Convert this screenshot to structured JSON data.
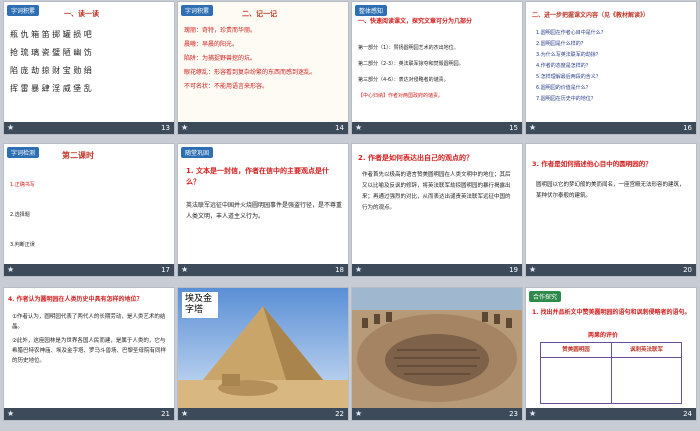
{
  "slides": [
    {
      "num": "13",
      "tag": "字词积累",
      "title": "一、读一读",
      "lines": [
        "瓶 仇 箱 笛 掷 罐 损 吧",
        "抢 琉 璃 瓷 璧 陋 幽 饬",
        "陷 庞 劫 掠 财 宝 勋 绢",
        "挥 雷 暴 肆 淫 威 堡 乱"
      ]
    },
    {
      "num": "14",
      "tag": "字词积累",
      "title": "二、记一记",
      "lines": [
        "瑰丽：奇特，珍贵而华丽。",
        "晨曦：早晨的阳光。",
        "陷阱：为捕捉野兽挖的坑。",
        "眼花缭乱：形容看到复杂纷繁的东西而感到迷乱。",
        "不可名状：不能用语言来形容。"
      ]
    },
    {
      "num": "15",
      "tag": "整体感知",
      "title": "一、快速阅读课文，探究文章可分为几部分",
      "lines": [
        "第一部分（1）：赞扬圆明园艺术的杰出地位。",
        "第二部分（2-3）：英法联军掠夺和焚毁圆明园。",
        "第三部分（4-6）：表达对侵略者的谴责。",
        "【中心归纳】作者对两国政府的谴责。"
      ]
    },
    {
      "num": "16",
      "tag": "",
      "title": "二、进一步把握课文内容（见《教材解读》）",
      "lines": [
        "1.圆明园在作者心目中是什么？",
        "2.圆明园是什么样的？",
        "3.为什么写英法联军的劫掠？",
        "4.作者的态度是怎样的？",
        "5.怎样理解最后两段的含义？",
        "6.圆明园的价值是什么？",
        "7.圆明园在历史中的地位？"
      ]
    },
    {
      "num": "17",
      "tag": "字词检测",
      "title": "第二课时",
      "lines": [
        "1.正确书写",
        "2.选择题",
        "3.判断正误"
      ]
    },
    {
      "num": "18",
      "tag": "随堂巩固",
      "title": "1. 文本是一封信，作者在信中的主要观点是什么？",
      "lines": [
        "英法联军远征中国并火烧圆明园事件是强盗行径，是不尊重人类文明，丰人道主义行为。"
      ]
    },
    {
      "num": "19",
      "tag": "",
      "title": "2. 作者是如何表达出自己的观点的？",
      "lines": [
        "作者首先以极高的语言赞美圆明园在人类文明中的地位；其后又以比喻及反讽的修辞，将英法联军劫掠圆明园的暴行揭露出来；再通过强烈的对比，从而表达出谴责英法联军远征中国的行为的观点。"
      ]
    },
    {
      "num": "20",
      "tag": "",
      "title": "3. 作者是如何描述他心目中的圆明园的？",
      "lines": [
        "圆明园以它的梦幻般的美而闻名，一座宫殿无法形容的建筑，某种伏尔泰般的建筑。"
      ]
    },
    {
      "num": "21",
      "tag": "",
      "title": "4. 作者认为圆明园在人类历史中具有怎样的地位？",
      "lines": [
        "①作者认为，圆明园代表了两代人的长期劳动，是人类艺术的结晶。",
        "②此外，这座园林是为世界各国人民而建，是属于人类的，它与希腊巴特农神庙、埃及金字塔、罗马斗兽场、巴黎圣母院有同样的历史地位。"
      ]
    },
    {
      "num": "22",
      "tag": "",
      "title": "埃及金字塔",
      "lines": []
    },
    {
      "num": "23",
      "tag": "",
      "title": "",
      "lines": []
    },
    {
      "num": "24",
      "tag": "合作探究",
      "title": "1. 找出并品析文中赞美圆明园的语句和讽刺侵略者的语句。",
      "table_title": "两果的评价",
      "cols": [
        "赞美圆明园",
        "讽刺英法联军"
      ]
    }
  ]
}
